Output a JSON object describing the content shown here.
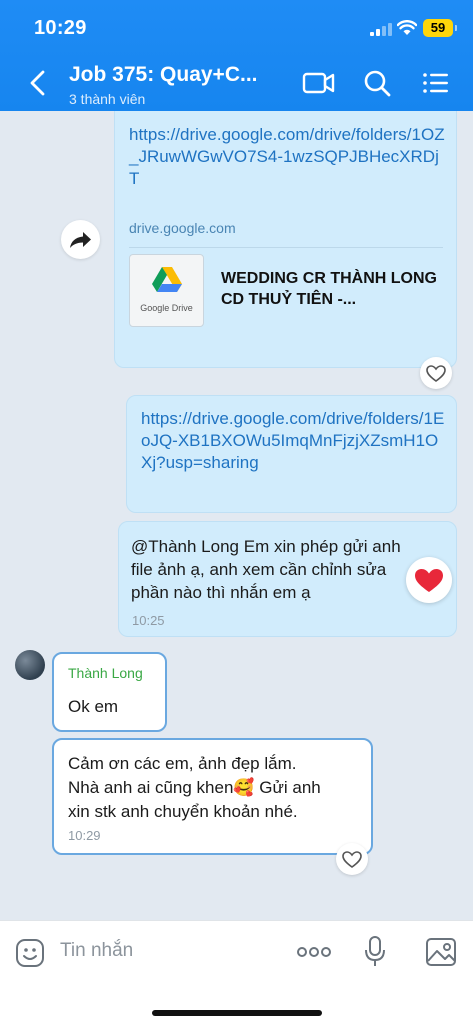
{
  "status": {
    "time": "10:29",
    "battery": "59"
  },
  "header": {
    "title": "Job 375: Quay+C...",
    "subtitle": "3 thành viên"
  },
  "messages": {
    "drive_card": {
      "link": "https://drive.google.com/drive/folders/1OZ_JRuwWGwVO7S4-1wzSQPJBHecXRDjT",
      "domain": "drive.google.com",
      "thumb_label": "Google Drive",
      "preview_title": "WEDDING CR THÀNH LONG CD THUỶ TIÊN -..."
    },
    "link2": "https://drive.google.com/drive/folders/1EoJQ-XB1BXOWu5ImqMnFjzjXZsmH1OXj?usp=sharing",
    "msg3": {
      "line1": "@Thành Long  Em xin phép gửi anh",
      "line2": "file ảnh ạ, anh xem cần chỉnh sửa",
      "line3": "phần nào thì nhắn em ạ",
      "time": "10:25"
    },
    "reply1": {
      "sender": "Thành Long",
      "text": "Ok em"
    },
    "reply2": {
      "line1": "Cảm ơn các em, ảnh đẹp lắm.",
      "line2": "Nhà anh ai cũng khen🥰 Gửi anh",
      "line3": "xin stk anh chuyển khoản nhé.",
      "time": "10:29"
    }
  },
  "input": {
    "placeholder": "Tin nhắn"
  },
  "colors": {
    "header": "#1685ef",
    "bubble_sent": "#d1ecfc",
    "bubble_received_border": "#6aa8e0",
    "sender_name": "#3aa845"
  }
}
